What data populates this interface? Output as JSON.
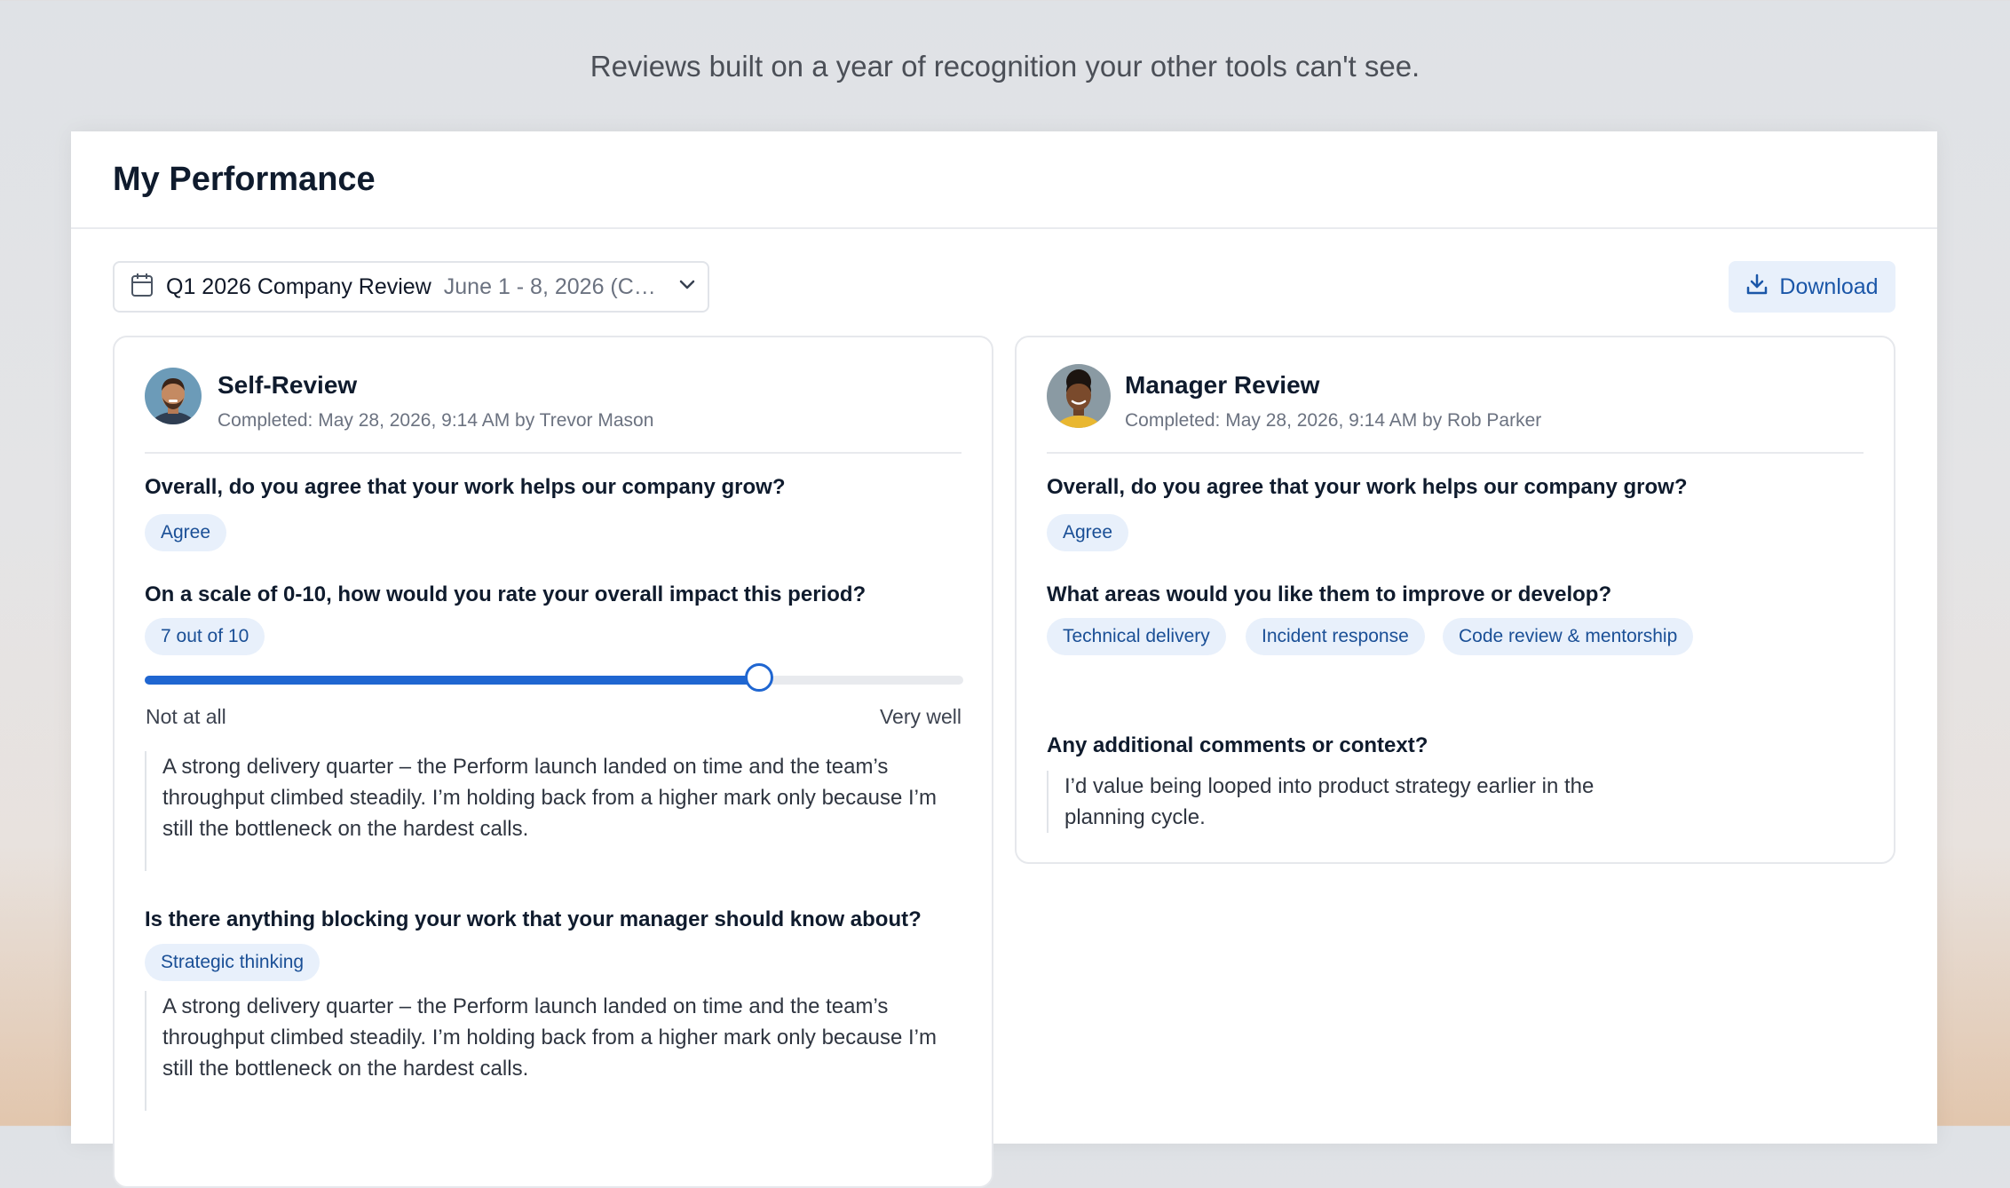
{
  "tagline": "Reviews built on a year of recognition your other tools can't see.",
  "page_title": "My Performance",
  "period": {
    "name": "Q1 2026 Company Review",
    "dates": "June 1 - 8, 2026 (Cur..."
  },
  "download_label": "Download",
  "self_review": {
    "title": "Self-Review",
    "completed": "Completed: May 28, 2026, 9:14 AM by Trevor Mason",
    "q1": "Overall, do you agree that your work helps our company grow?",
    "a1": "Agree",
    "q2": "On a scale of 0-10, how would you rate your overall impact this period?",
    "a2": "7 out of 10",
    "rating_fraction": 0.75,
    "scale_min_label": "Not at all",
    "scale_max_label": "Very well",
    "comment1": "A strong delivery quarter – the Perform launch landed on time and the team’s throughput climbed steadily. I’m holding back from a higher mark only because I’m still the bottleneck on the hardest calls.",
    "q3": "Is there anything blocking your work that your manager should know about?",
    "a3": "Strategic thinking",
    "comment2": "A strong delivery quarter – the Perform launch landed on time and the team’s throughput climbed steadily. I’m holding back from a higher mark only because I’m still the bottleneck on the hardest calls."
  },
  "manager_review": {
    "title": "Manager Review",
    "completed": "Completed: May 28, 2026, 9:14 AM by Rob Parker",
    "q1": "Overall, do you agree that your work helps our company grow?",
    "a1": "Agree",
    "q2": "What areas would you like them to improve or develop?",
    "areas": [
      "Technical delivery",
      "Incident response",
      "Code review & mentorship"
    ],
    "q3": "Any additional comments or context?",
    "comment": "I’d value being looped into product strategy earlier in the planning cycle."
  },
  "colors": {
    "accent": "#1f66d1",
    "pill_bg": "#e8f0fb",
    "pill_text": "#1a4f96"
  }
}
